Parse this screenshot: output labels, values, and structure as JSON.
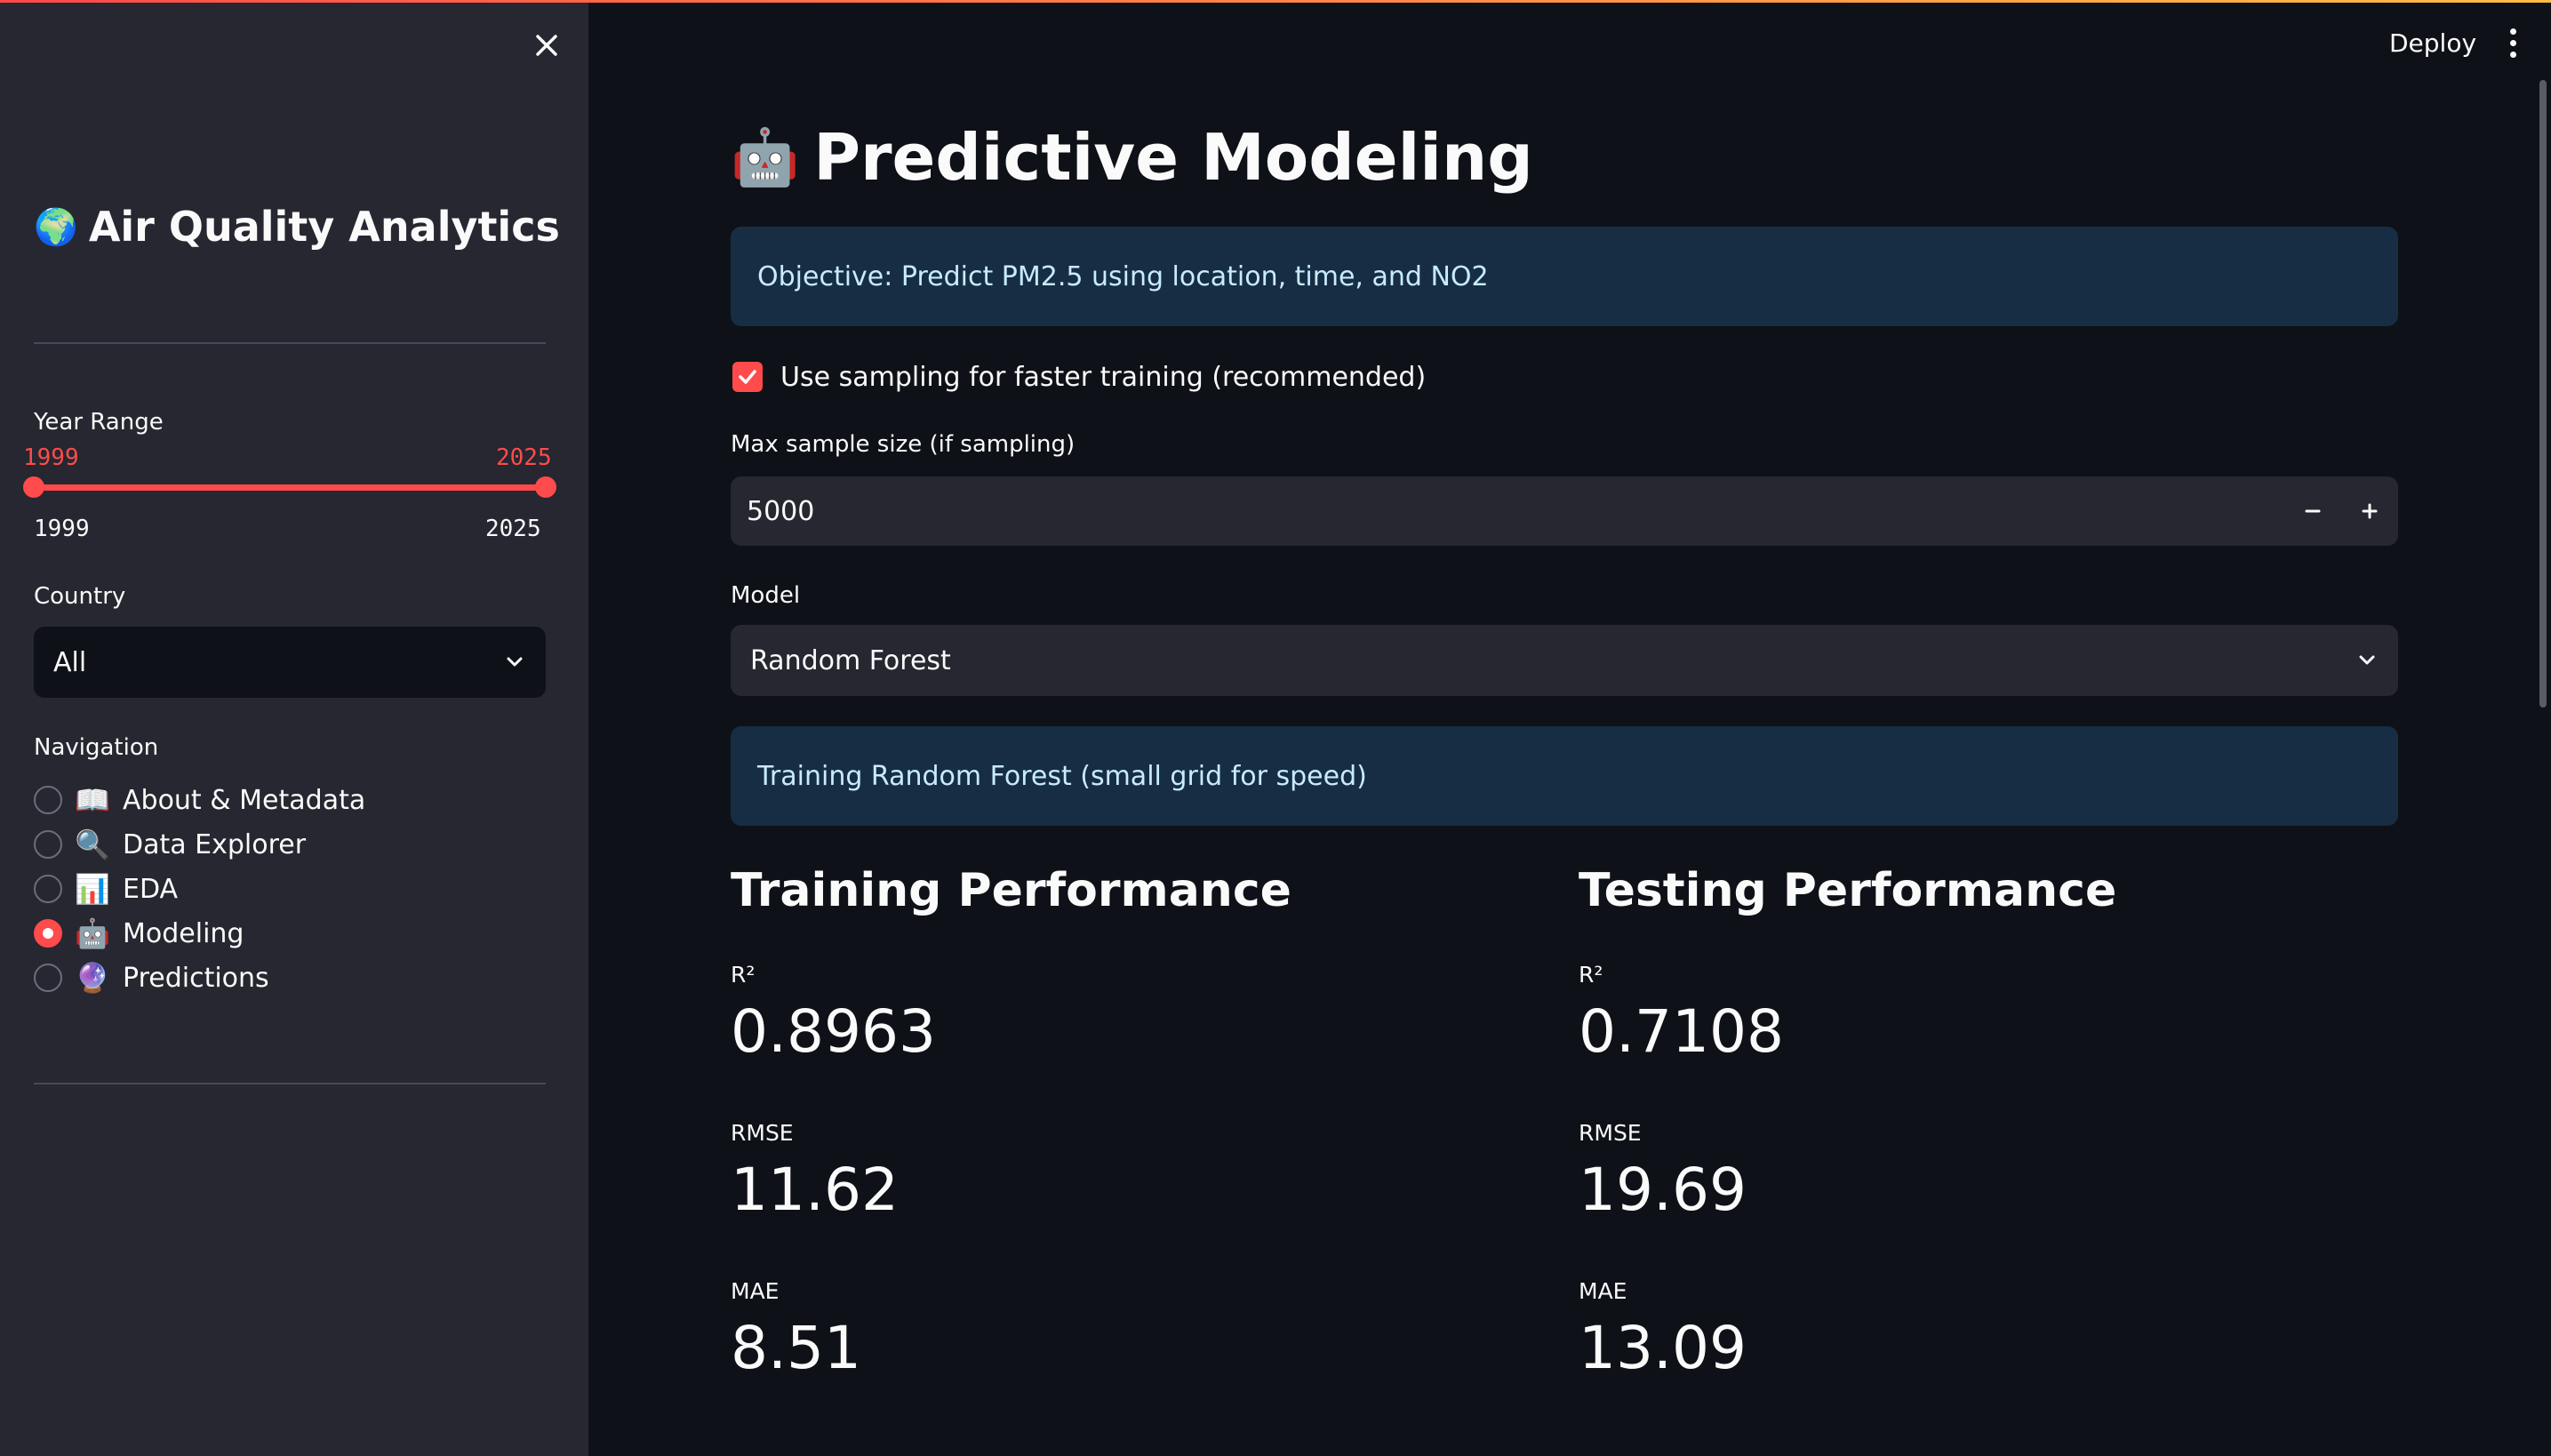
{
  "sidebar": {
    "title": "Air Quality Analytics",
    "title_icon": "globe-icon",
    "year_range": {
      "label": "Year Range",
      "low": "1999",
      "high": "2025",
      "min": "1999",
      "max": "2025"
    },
    "country": {
      "label": "Country",
      "selected": "All"
    },
    "navigation": {
      "label": "Navigation",
      "items": [
        {
          "emoji": "📖",
          "label": "About & Metadata",
          "selected": false
        },
        {
          "emoji": "🔍",
          "label": "Data Explorer",
          "selected": false
        },
        {
          "emoji": "📊",
          "label": "EDA",
          "selected": false
        },
        {
          "emoji": "🤖",
          "label": "Modeling",
          "selected": true
        },
        {
          "emoji": "🔮",
          "label": "Predictions",
          "selected": false
        }
      ]
    }
  },
  "header": {
    "deploy_label": "Deploy"
  },
  "main": {
    "title_emoji": "🤖",
    "title": "Predictive Modeling",
    "objective": "Objective: Predict PM2.5 using location, time, and NO2",
    "sampling_checkbox": {
      "label": "Use sampling for faster training (recommended)",
      "checked": true
    },
    "sample_size": {
      "label": "Max sample size (if sampling)",
      "value": "5000"
    },
    "model": {
      "label": "Model",
      "selected": "Random Forest"
    },
    "training_info": "Training Random Forest (small grid for speed)",
    "training_performance": {
      "heading": "Training Performance",
      "r2_label": "R²",
      "r2": "0.8963",
      "rmse_label": "RMSE",
      "rmse": "11.62",
      "mae_label": "MAE",
      "mae": "8.51"
    },
    "testing_performance": {
      "heading": "Testing Performance",
      "r2_label": "R²",
      "r2": "0.7108",
      "rmse_label": "RMSE",
      "rmse": "19.69",
      "mae_label": "MAE",
      "mae": "13.09"
    }
  },
  "colors": {
    "accent": "#ff4b4b",
    "background": "#0e1117",
    "sidebar": "#262730",
    "info_bg": "#172d43",
    "info_text": "#c7ebff"
  }
}
